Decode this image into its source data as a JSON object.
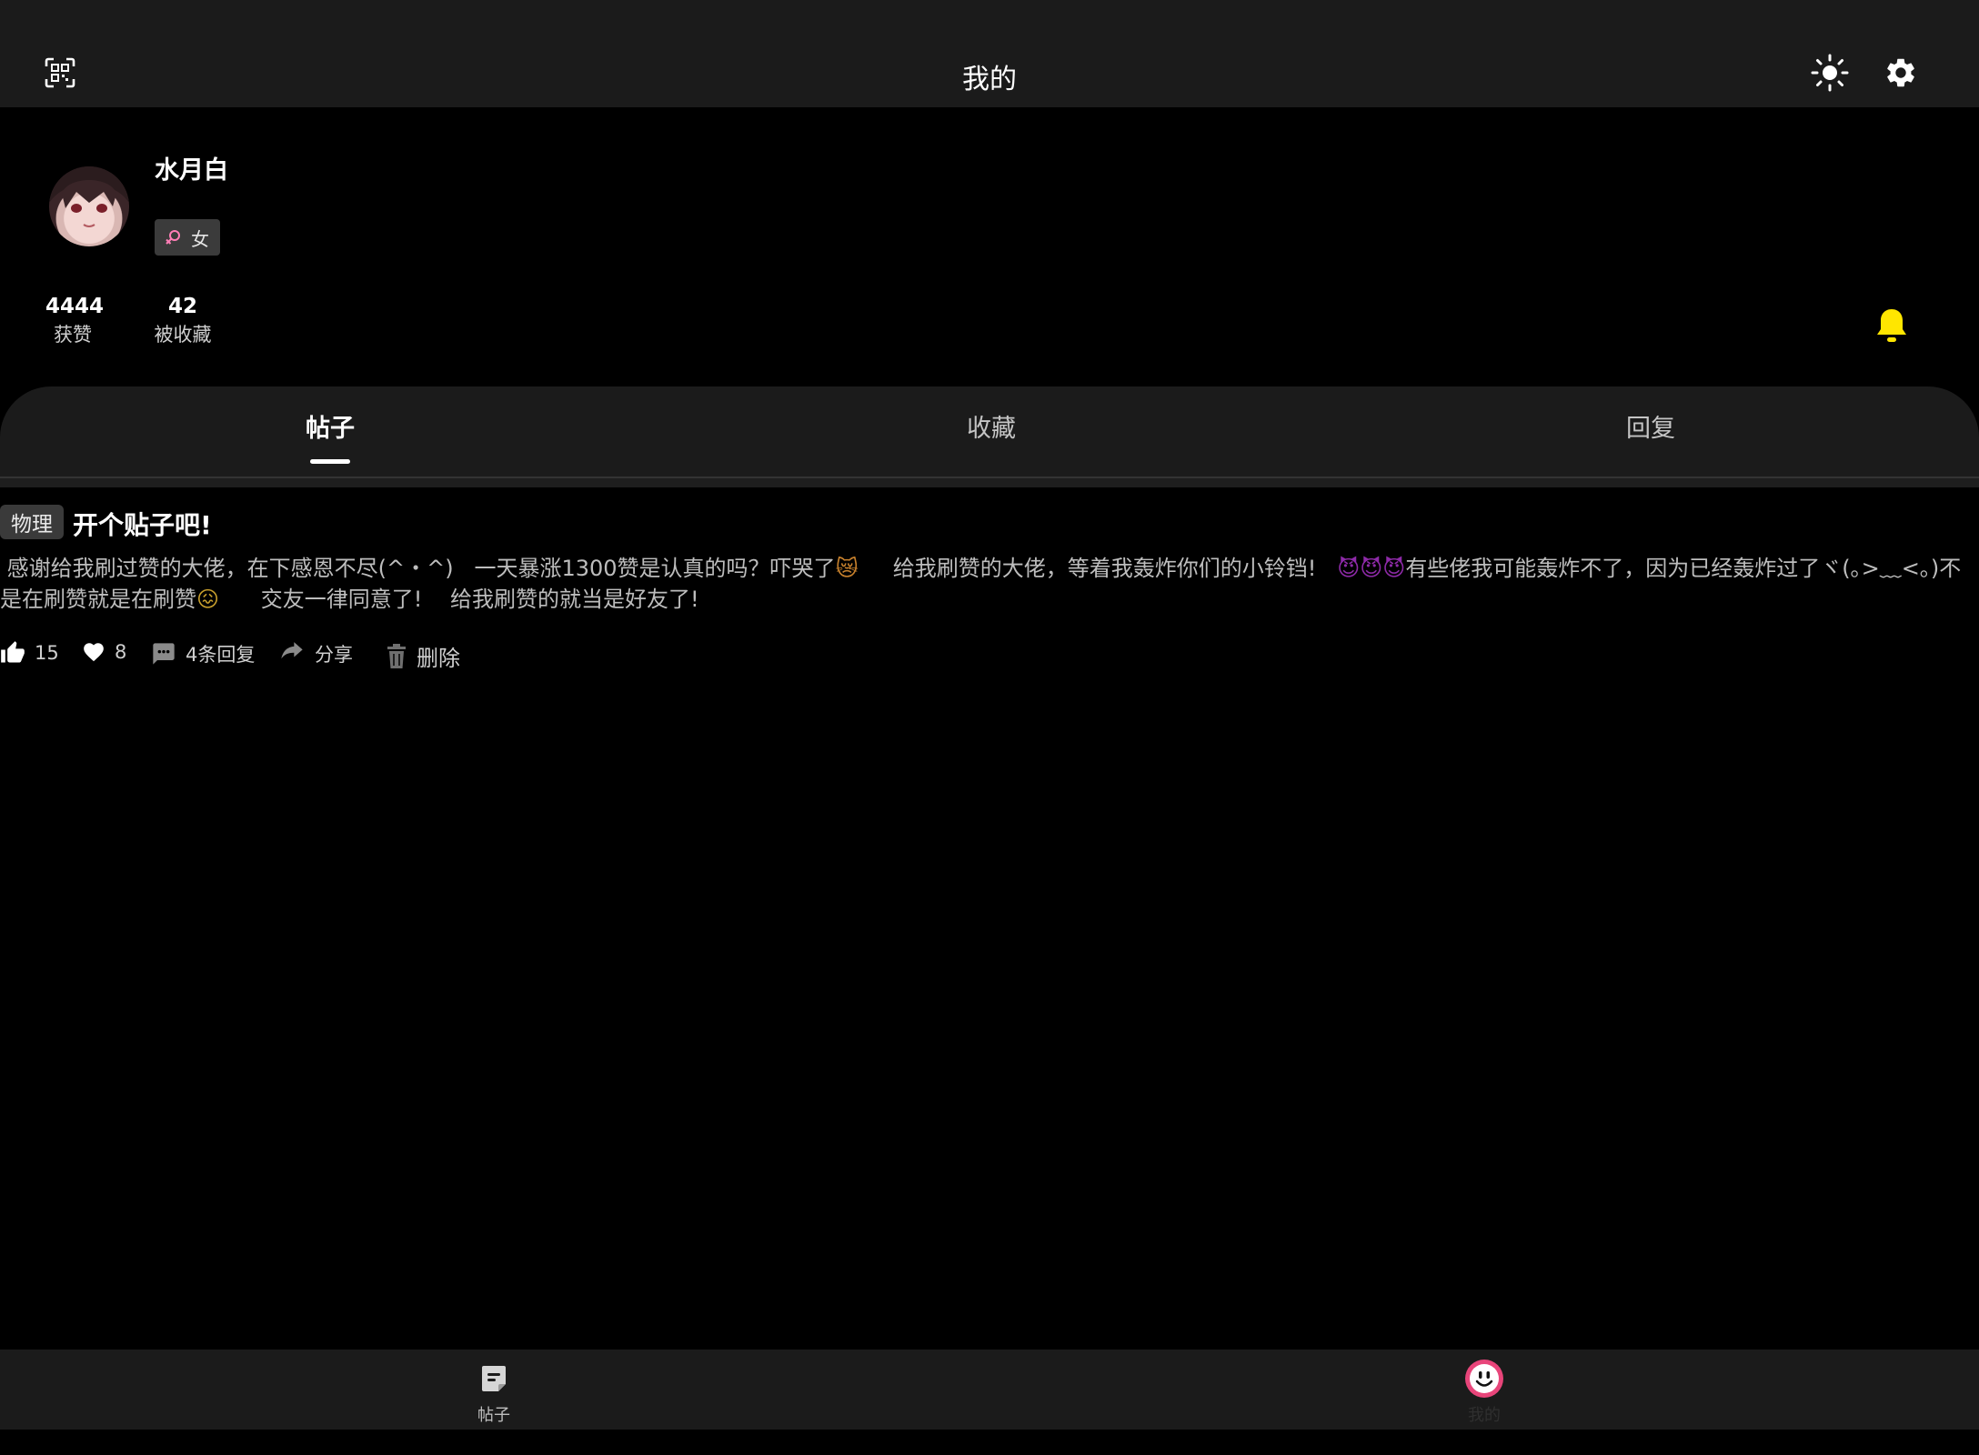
{
  "header": {
    "title": "我的",
    "scan_icon": "qr-scan-icon",
    "theme_icon": "sun-icon",
    "settings_icon": "gear-icon"
  },
  "profile": {
    "name": "水月白",
    "gender": "女",
    "gender_icon": "female-symbol-icon",
    "likes_count": "4444",
    "likes_label": "获赞",
    "favorited_count": "42",
    "favorited_label": "被收藏",
    "bell_icon": "bell-icon"
  },
  "tabs": [
    {
      "label": "帖子",
      "active": true
    },
    {
      "label": "收藏",
      "active": false
    },
    {
      "label": "回复",
      "active": false
    }
  ],
  "post": {
    "tag": "物理",
    "title": "开个贴子吧!",
    "body_parts": [
      " 感谢给我刷过赞的大佬，在下感恩不尽(^・^)   一天暴涨1300赞是认真的吗？吓哭了",
      "😿",
      "     给我刷赞的大佬，等着我轰炸你们的小铃铛!   ",
      "😈😈😈",
      "有些佬我可能轰炸不了，因为已经轰炸过了ヾ(｡>﹏<｡)不是在刷赞就是在刷赞",
      "😖",
      "      交友一律同意了!    给我刷赞的就当是好友了!"
    ],
    "like_count": "15",
    "heart_count": "8",
    "reply_label": "4条回复",
    "share_label": "分享",
    "delete_label": "删除"
  },
  "bottom_nav": [
    {
      "label": "帖子",
      "icon": "posts-icon"
    },
    {
      "label": "我的",
      "icon": "smiley-face-icon"
    }
  ],
  "colors": {
    "bar_bg": "#1b1b1b",
    "page_bg": "#000000",
    "bell": "#ffe600",
    "gender_symbol": "#ff7eb6",
    "me_icon_ring": "#e8457a"
  }
}
